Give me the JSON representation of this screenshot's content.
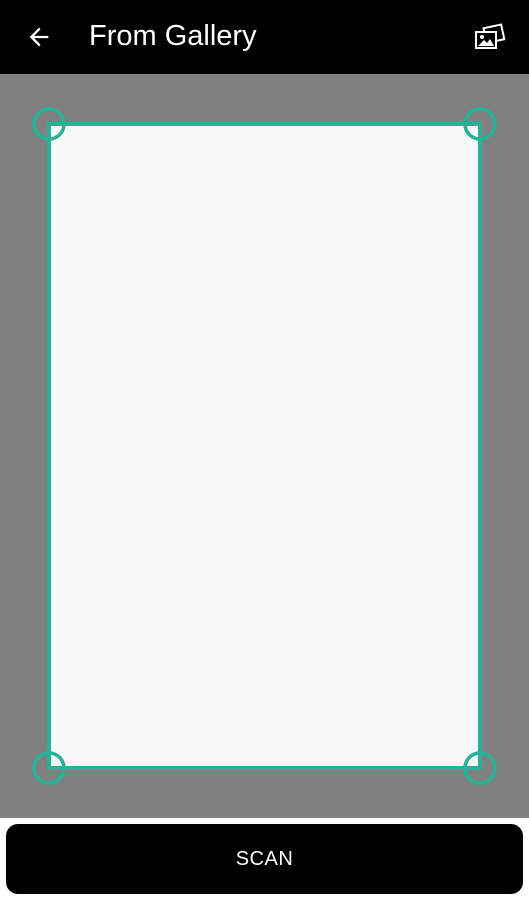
{
  "toolbar": {
    "title": "From Gallery",
    "back_icon": "arrow-left-icon",
    "gallery_icon": "gallery-photos-icon"
  },
  "colors": {
    "toolbar_bg": "#000000",
    "workspace_bg": "#808080",
    "document_bg": "#f8f8f8",
    "crop_accent": "#27b197",
    "button_bg": "#000000",
    "button_text": "#ffffff"
  },
  "crop": {
    "handle_icon": "circle-handle"
  },
  "actions": {
    "scan_label": "SCAN"
  }
}
